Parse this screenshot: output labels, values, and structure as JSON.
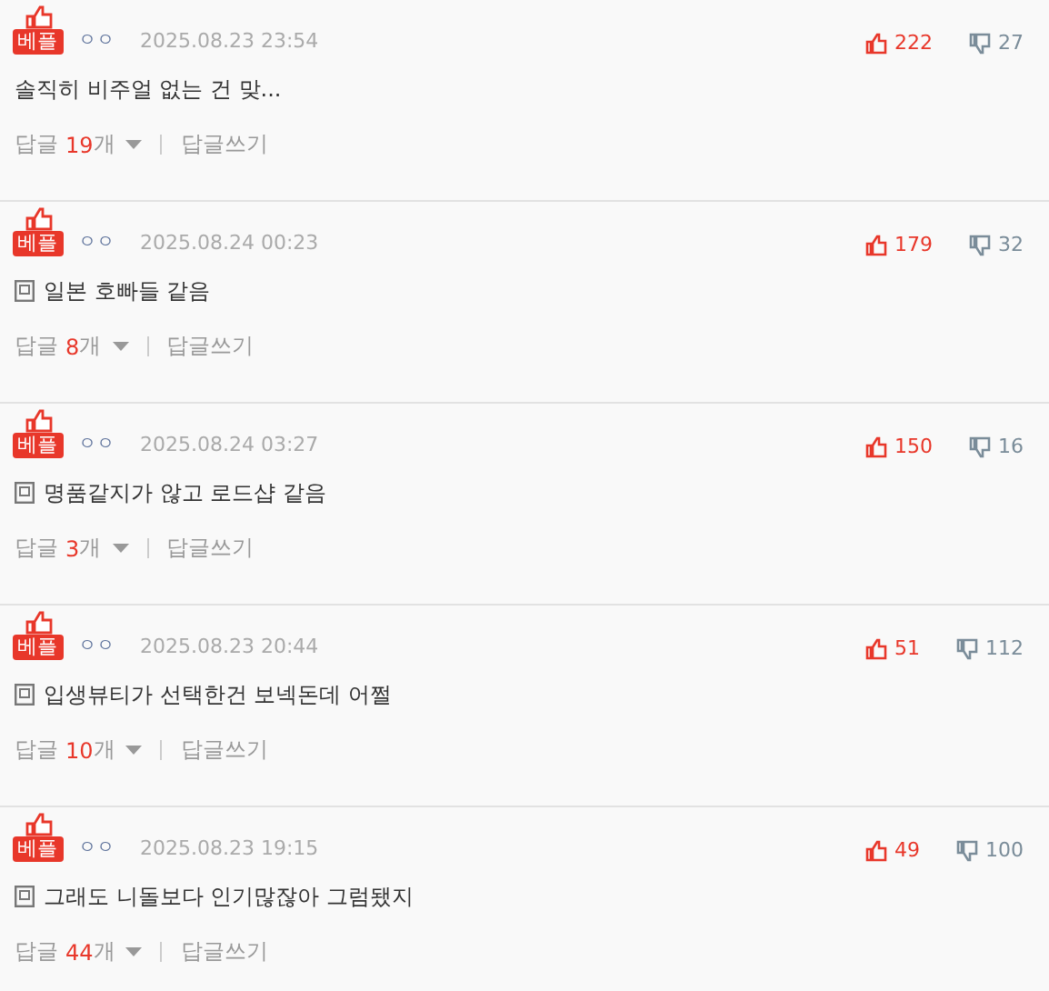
{
  "comments": [
    {
      "badge": "베플",
      "author": "ㅇㅇ",
      "date": "2025.08.23 23:54",
      "likes": "222",
      "dislikes": "27",
      "memo": false,
      "text": "솔직히 비주얼 없는 건 맞...",
      "reply_label": "답글",
      "reply_count": "19",
      "reply_unit": "개",
      "write_reply": "답글쓰기"
    },
    {
      "badge": "베플",
      "author": "ㅇㅇ",
      "date": "2025.08.24 00:23",
      "likes": "179",
      "dislikes": "32",
      "memo": true,
      "text": "일본 호빠들 같음",
      "reply_label": "답글",
      "reply_count": "8",
      "reply_unit": "개",
      "write_reply": "답글쓰기"
    },
    {
      "badge": "베플",
      "author": "ㅇㅇ",
      "date": "2025.08.24 03:27",
      "likes": "150",
      "dislikes": "16",
      "memo": true,
      "text": "명품같지가 않고 로드샵 같음",
      "reply_label": "답글",
      "reply_count": "3",
      "reply_unit": "개",
      "write_reply": "답글쓰기"
    },
    {
      "badge": "베플",
      "author": "ㅇㅇ",
      "date": "2025.08.23 20:44",
      "likes": "51",
      "dislikes": "112",
      "memo": true,
      "text": "입생뷰티가 선택한건 보넥돈데 어쩔",
      "reply_label": "답글",
      "reply_count": "10",
      "reply_unit": "개",
      "write_reply": "답글쓰기"
    },
    {
      "badge": "베플",
      "author": "ㅇㅇ",
      "date": "2025.08.23 19:15",
      "likes": "49",
      "dislikes": "100",
      "memo": true,
      "text": "그래도 니돌보다 인기많잖아 그럼됐지",
      "reply_label": "답글",
      "reply_count": "44",
      "reply_unit": "개",
      "write_reply": "답글쓰기"
    }
  ]
}
